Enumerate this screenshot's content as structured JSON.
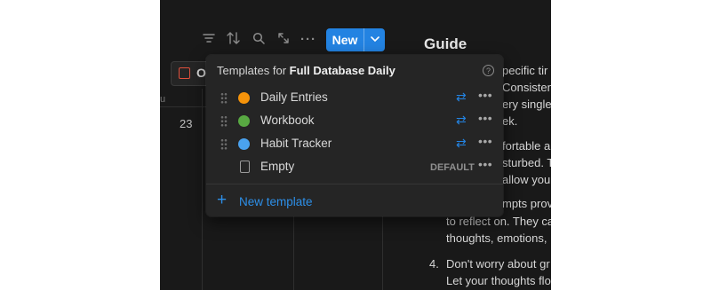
{
  "toolbar": {
    "icons": [
      "filter-icon",
      "sort-icon",
      "search-icon",
      "expand-icon",
      "more-icon"
    ],
    "new_label": "New"
  },
  "guide_title": "Guide",
  "view_chip": "Op",
  "background": {
    "day_number": "23",
    "col_hint": "u",
    "right_lines": [
      "pecific tir",
      "Consisten",
      "ery single",
      "ek.",
      "fortable a",
      "sturbed. T",
      "allow your",
      "mpts prov",
      "to reflect on. They ca",
      "thoughts, emotions,",
      "Don't worry about gr",
      "Let your thoughts flo"
    ],
    "list_number": "4."
  },
  "popup": {
    "title_prefix": "Templates for ",
    "title_db": "Full Database Daily",
    "templates": [
      {
        "name": "Daily Entries",
        "color": "#f5930a"
      },
      {
        "name": "Workbook",
        "color": "#58a942"
      },
      {
        "name": "Habit Tracker",
        "color": "#4aa2ee"
      }
    ],
    "empty_label": "Empty",
    "default_badge": "DEFAULT",
    "new_template_label": "New template"
  }
}
